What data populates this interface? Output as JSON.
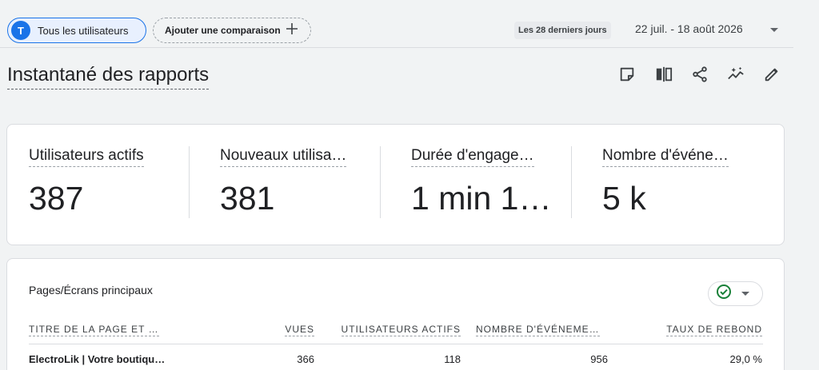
{
  "topbar": {
    "segment": {
      "avatar_letter": "T",
      "label": "Tous les utilisateurs"
    },
    "compare": {
      "label": "Ajouter une comparaison",
      "icon": "plus-icon"
    },
    "date_range": {
      "preset": "Les 28 derniers jours",
      "dates": "22 juil. - 18 août 2026",
      "icon": "caret-down-icon"
    }
  },
  "page": {
    "title": "Instantané des rapports",
    "tools": [
      "note-icon",
      "compare-view-icon",
      "share-icon",
      "insights-icon",
      "edit-icon"
    ]
  },
  "metrics": [
    {
      "label": "Utilisateurs actifs",
      "value": "387"
    },
    {
      "label": "Nouveaux utilisa…",
      "value": "381"
    },
    {
      "label": "Durée d'engage…",
      "value": "1 min 1…"
    },
    {
      "label": "Nombre d'événe…",
      "value": "5 k"
    }
  ],
  "table": {
    "title": "Pages/Écrans principaux",
    "status_icon": "check-circle-icon",
    "columns": [
      "TITRE DE LA PAGE ET …",
      "VUES",
      "UTILISATEURS ACTIFS",
      "NOMBRE D'ÉVÉNEME…",
      "TAUX DE REBOND"
    ],
    "rows": [
      {
        "title": "ElectroLik | Votre boutiqu…",
        "views": "366",
        "active_users": "118",
        "events": "956",
        "bounce_rate": "29,0 %"
      }
    ]
  },
  "colors": {
    "accent": "#1a73e8",
    "background": "#f1f3f4",
    "card": "#ffffff",
    "success": "#188038"
  }
}
